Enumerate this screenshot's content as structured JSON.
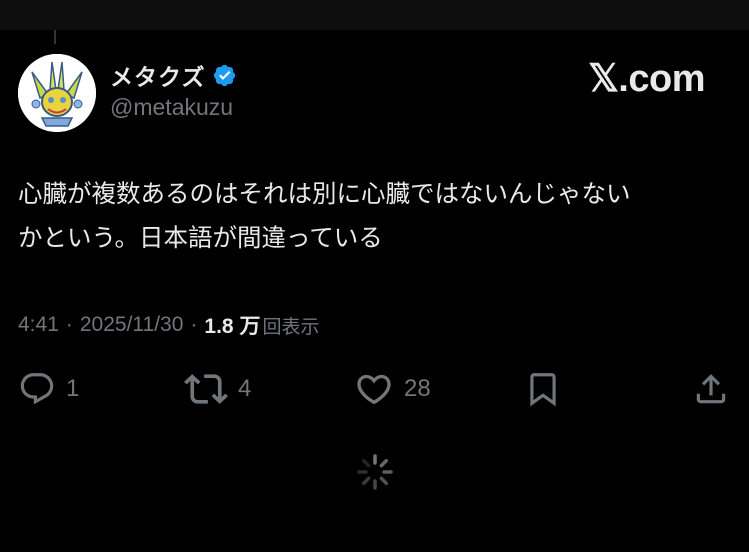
{
  "tweet": {
    "author": {
      "display_name": "メタクズ",
      "handle": "@metakuzu",
      "verified": true,
      "verified_color": "#1d9bf0"
    },
    "brand": "𝕏.com",
    "text_lines": [
      "心臓が複数あるのはそれは別に心臓ではないんじゃない",
      "かという。日本語が間違っている"
    ],
    "time": "4:41",
    "separator": "·",
    "date": "2025/11/30",
    "views_count": "1.8 万",
    "views_label": "回表示"
  },
  "actions": {
    "reply_count": "1",
    "repost_count": "4",
    "like_count": "28"
  },
  "icons": {
    "reply": "reply-icon",
    "repost": "repost-icon",
    "like": "heart-icon",
    "bookmark": "bookmark-icon",
    "share": "share-icon",
    "loading": "loading-spinner-icon"
  },
  "colors": {
    "background": "#000000",
    "text_primary": "#e7e9ea",
    "text_secondary": "#71767b",
    "accent": "#1d9bf0"
  }
}
